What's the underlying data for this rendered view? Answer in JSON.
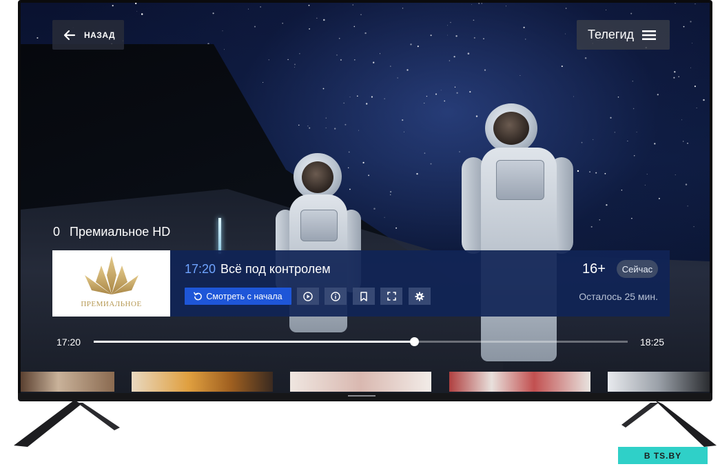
{
  "header": {
    "back_label": "НАЗАД",
    "guide_label": "Телегид"
  },
  "channel": {
    "number": "0",
    "name": "Премиальное HD",
    "logo_text": "ПРЕМИАЛЬНОЕ"
  },
  "program": {
    "start_time": "17:20",
    "title": "Всё под контролем",
    "age_rating": "16+",
    "now_badge": "Сейчас",
    "watch_from_start_label": "Смотреть с начала",
    "remaining": "Осталось 25 мин."
  },
  "controls": [
    {
      "name": "play-icon"
    },
    {
      "name": "info-icon"
    },
    {
      "name": "bookmark-icon"
    },
    {
      "name": "fullscreen-icon"
    },
    {
      "name": "settings-icon"
    }
  ],
  "progress": {
    "start": "17:20",
    "end": "18:25",
    "fraction": 0.6
  },
  "colors": {
    "accent": "#1e56d8",
    "panel": "#102456",
    "time_highlight": "#6fa4ff"
  },
  "watermark": "B  TS.BY"
}
